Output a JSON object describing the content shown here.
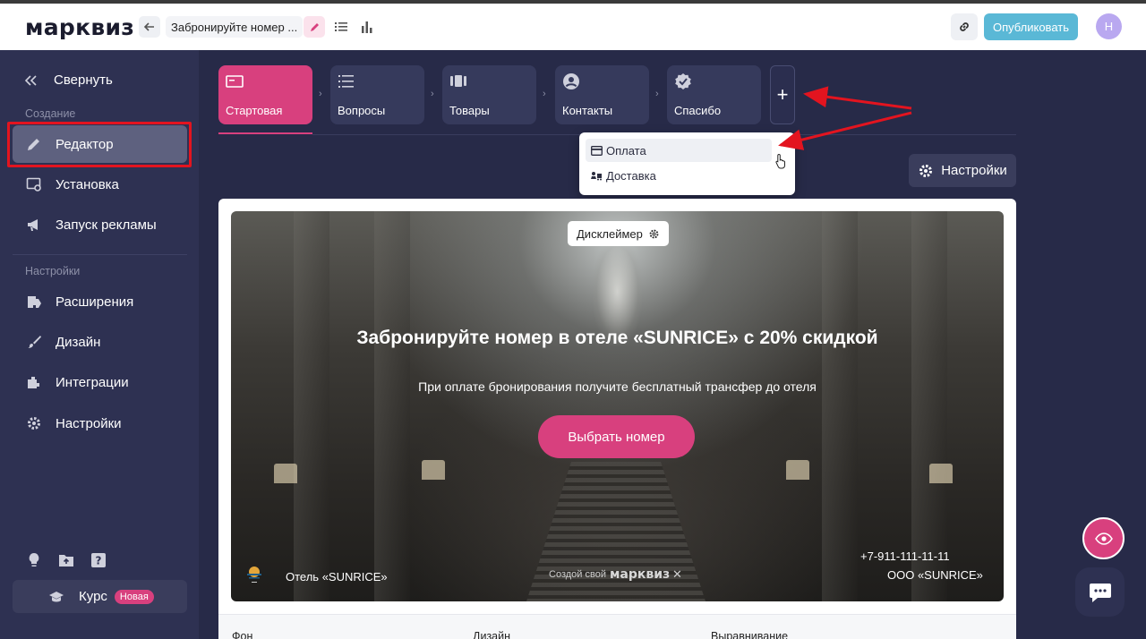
{
  "header": {
    "logo": "марквиз",
    "quiz_title": "Забронируйте номер ...",
    "publish_label": "Опубликовать",
    "avatar_initial": "Н"
  },
  "sidebar": {
    "collapse_label": "Свернуть",
    "section_create": "Создание",
    "section_settings": "Настройки",
    "items": [
      {
        "label": "Редактор",
        "icon": "pencil-icon",
        "active": true
      },
      {
        "label": "Установка",
        "icon": "install-icon"
      },
      {
        "label": "Запуск рекламы",
        "icon": "megaphone-icon"
      },
      {
        "label": "Расширения",
        "icon": "puzzle-icon"
      },
      {
        "label": "Дизайн",
        "icon": "brush-icon"
      },
      {
        "label": "Интеграции",
        "icon": "integration-icon"
      },
      {
        "label": "Настройки",
        "icon": "gear-icon"
      }
    ],
    "course_label": "Курс",
    "course_badge": "Новая"
  },
  "steps": [
    {
      "label": "Стартовая",
      "icon": "screen-icon",
      "active": true
    },
    {
      "label": "Вопросы",
      "icon": "list-icon"
    },
    {
      "label": "Товары",
      "icon": "products-icon"
    },
    {
      "label": "Контакты",
      "icon": "user-circle-icon"
    },
    {
      "label": "Спасибо",
      "icon": "check-badge-icon"
    }
  ],
  "add_step_label": "+",
  "dropdown": {
    "items": [
      {
        "label": "Оплата",
        "icon": "card-icon"
      },
      {
        "label": "Доставка",
        "icon": "delivery-icon"
      }
    ]
  },
  "settings_button": "Настройки",
  "preview": {
    "disclaimer": "Дисклеймер",
    "title": "Забронируйте номер в отеле «SUNRICE» с 20% скидкой",
    "subtitle": "При оплате бронирования получите бесплатный трансфер до отеля",
    "cta": "Выбрать номер",
    "company_short": "Отель «SUNRICE»",
    "made_with": "Создой свой",
    "made_with_brand": "марквиз",
    "close": "✕",
    "phone": "+7-911-111-11-11",
    "company_legal": "ООО «SUNRICE»"
  },
  "bottom_bar": {
    "bg": "Фон",
    "design": "Дизайн",
    "align": "Выравнивание"
  },
  "colors": {
    "accent": "#d8407e",
    "sidebar": "#2e3152",
    "publish": "#5ab8d6",
    "annotation": "#e3141f"
  }
}
